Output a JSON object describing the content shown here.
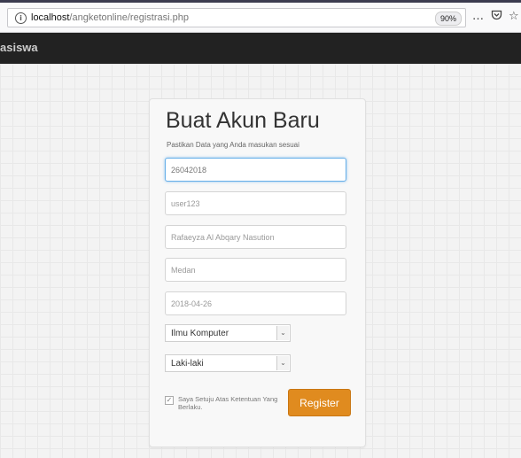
{
  "browser": {
    "url_host": "localhost",
    "url_path": "/angketonline/registrasi.php",
    "zoom": "90%",
    "menu_icon": "…",
    "pocket_icon": "pocket-icon",
    "star_icon": "☆"
  },
  "navbar": {
    "brand": "asiswa"
  },
  "form": {
    "title": "Buat Akun Baru",
    "subtitle": "Pastikan Data yang Anda masukan sesuai",
    "fields": [
      {
        "value": "26042018"
      },
      {
        "value": "user123"
      },
      {
        "value": "Rafaeyza Al Abqary Nasution"
      },
      {
        "value": "Medan"
      },
      {
        "value": "2018-04-26"
      }
    ],
    "major_select": "Ilmu Komputer",
    "gender_select": "Laki-laki",
    "agree_label": "Saya Setuju Atas Ketentuan Yang Berlaku.",
    "register_label": "Register"
  },
  "colors": {
    "navbar": "#222222",
    "register_button": "#e08b1f",
    "focus_border": "#66afe9"
  }
}
